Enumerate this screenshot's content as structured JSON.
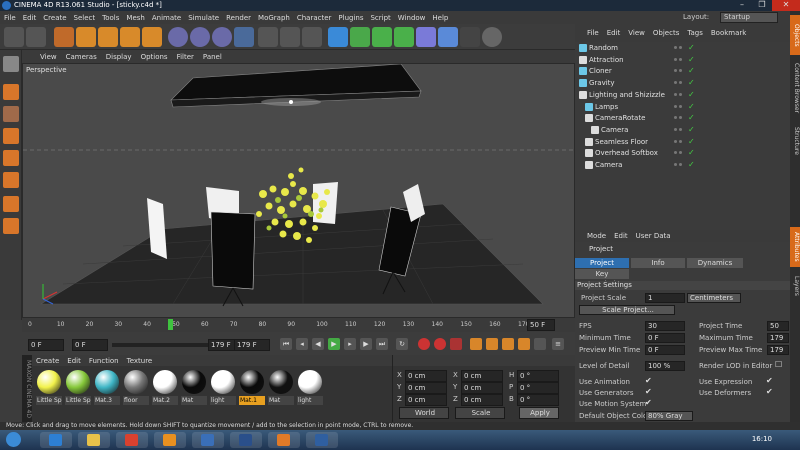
{
  "window": {
    "title": "CINEMA 4D R13.061 Studio - [sticky.c4d *]",
    "buttons": [
      "–",
      "❐",
      "✕"
    ]
  },
  "menubar": [
    "File",
    "Edit",
    "Create",
    "Select",
    "Tools",
    "Mesh",
    "Animate",
    "Simulate",
    "Render",
    "MoGraph",
    "Character",
    "Plugins",
    "Script",
    "Window",
    "Help"
  ],
  "layout": {
    "label": "Layout:",
    "value": "Startup"
  },
  "viewport": {
    "menu": [
      "View",
      "Cameras",
      "Display",
      "Options",
      "Filter",
      "Panel"
    ],
    "label": "Perspective"
  },
  "timeline": {
    "ticks": [
      "0",
      "10",
      "20",
      "30",
      "40",
      "50",
      "60",
      "70",
      "80",
      "90",
      "100",
      "110",
      "120",
      "130",
      "140",
      "150",
      "160",
      "170"
    ],
    "end_label": "50 F",
    "current_fraction": 0.286
  },
  "transport": {
    "start": "0 F",
    "min_field": "0 F",
    "max_field": "179 F",
    "end": "179 F"
  },
  "materials": {
    "menu": [
      "Create",
      "Edit",
      "Function",
      "Texture"
    ],
    "items": [
      {
        "name": "Little Sp",
        "color": "#f2f24a",
        "selected": false
      },
      {
        "name": "Little Sp",
        "color": "#86c83a",
        "selected": false
      },
      {
        "name": "Mat.3",
        "color": "#3fb6c6",
        "selected": false
      },
      {
        "name": "floor",
        "color": "#777777",
        "selected": false
      },
      {
        "name": "Mat.2",
        "color": "#ffffff",
        "selected": false
      },
      {
        "name": "Mat",
        "color": "#0a0a0a",
        "selected": false
      },
      {
        "name": "light",
        "color": "#ffffff",
        "selected": false
      },
      {
        "name": "Mat.1",
        "color": "#0a0a0a",
        "selected": true
      },
      {
        "name": "Mat",
        "color": "#111111",
        "selected": false
      },
      {
        "name": "light",
        "color": "#ffffff",
        "selected": false
      }
    ]
  },
  "coordinates": {
    "rows": [
      {
        "a": "X",
        "av": "0 cm",
        "b": "X",
        "bv": "0 cm",
        "c": "H",
        "cv": "0 °"
      },
      {
        "a": "Y",
        "av": "0 cm",
        "b": "Y",
        "bv": "0 cm",
        "c": "P",
        "cv": "0 °"
      },
      {
        "a": "Z",
        "av": "0 cm",
        "b": "Z",
        "bv": "0 cm",
        "c": "B",
        "cv": "0 °"
      }
    ],
    "world": "World",
    "scale": "Scale",
    "apply": "Apply"
  },
  "objects": {
    "menu": [
      "File",
      "Edit",
      "View",
      "Objects",
      "Tags",
      "Bookmark"
    ],
    "items": [
      {
        "label": "Random",
        "indent": 0,
        "color": "#6cc8e8"
      },
      {
        "label": "Attraction",
        "indent": 0,
        "color": "#dddddd"
      },
      {
        "label": "Cloner",
        "indent": 0,
        "color": "#6cc8e8"
      },
      {
        "label": "Gravity",
        "indent": 0,
        "color": "#6cc8e8"
      },
      {
        "label": "Lighting and Shizizzle",
        "indent": 0,
        "color": "#dddddd"
      },
      {
        "label": "Lamps",
        "indent": 1,
        "color": "#6cc8e8"
      },
      {
        "label": "CameraRotate",
        "indent": 1,
        "color": "#dddddd"
      },
      {
        "label": "Camera",
        "indent": 2,
        "color": "#dddddd"
      },
      {
        "label": "Seamless Floor",
        "indent": 1,
        "color": "#dddddd"
      },
      {
        "label": "Overhead Softbox",
        "indent": 1,
        "color": "#dddddd"
      },
      {
        "label": "Camera",
        "indent": 1,
        "color": "#dddddd"
      }
    ]
  },
  "attributes": {
    "menu": [
      "Mode",
      "Edit",
      "User Data"
    ],
    "object": "Project",
    "tabs": [
      "Project Settings",
      "Info",
      "Dynamics",
      "Key Interpolation"
    ],
    "section": "Project Settings",
    "project_scale_label": "Project Scale",
    "project_scale_value": "1",
    "project_scale_unit": "Centimeters",
    "scale_project_button": "Scale Project...",
    "fps_label": "FPS",
    "fps_value": "30",
    "min_time_label": "Minimum Time",
    "min_time_value": "0 F",
    "preview_min_label": "Preview Min Time",
    "preview_min_value": "0 F",
    "project_time_label": "Project Time",
    "project_time_value": "50",
    "max_time_label": "Maximum Time",
    "max_time_value": "179",
    "preview_max_label": "Preview Max Time",
    "preview_max_value": "179",
    "lod_label": "Level of Detail",
    "lod_value": "100 %",
    "render_lod_label": "Render LOD in Editor",
    "use_animation": "Use Animation",
    "use_generators": "Use Generators",
    "use_motion": "Use Motion System",
    "use_expression": "Use Expression",
    "use_deformers": "Use Deformers",
    "default_color_label": "Default Object Color",
    "default_color_value": "80% Gray"
  },
  "sidetabs": [
    "Objects",
    "Content Browser",
    "Structure",
    "Attributes",
    "Layers"
  ],
  "status": "Move: Click and drag to move elements. Hold down SHIFT to quantize movement / add to the selection in point mode, CTRL to remove.",
  "taskbar": {
    "clock": "16:10",
    "icons": [
      {
        "name": "start-orb",
        "color": "#3b8bd6"
      },
      {
        "name": "ie",
        "color": "#2d7fd4"
      },
      {
        "name": "explorer",
        "color": "#e8c24a"
      },
      {
        "name": "chrome",
        "color": "#d9412f"
      },
      {
        "name": "media",
        "color": "#e89020"
      },
      {
        "name": "cinema4d",
        "color": "#3a6fb8"
      },
      {
        "name": "photoshop",
        "color": "#2a4f8a"
      },
      {
        "name": "firefox",
        "color": "#e07a28"
      },
      {
        "name": "cinema4d-2",
        "color": "#2f5fa0"
      }
    ]
  }
}
